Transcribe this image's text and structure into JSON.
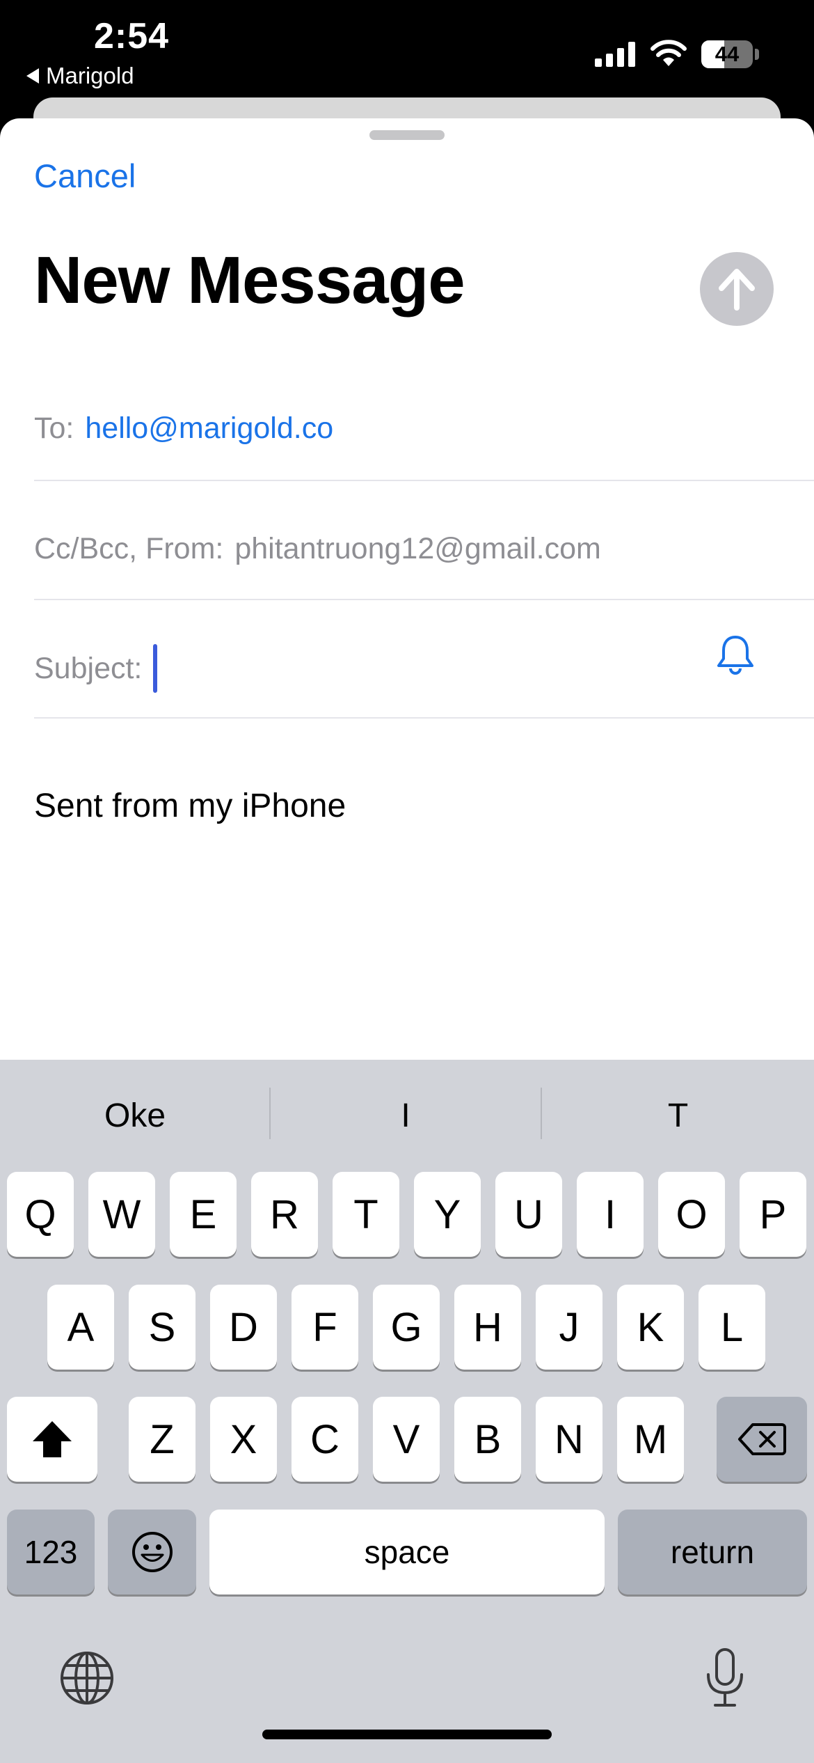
{
  "status_bar": {
    "time": "2:54",
    "back_app": "Marigold",
    "battery_percent": 44
  },
  "compose": {
    "cancel_label": "Cancel",
    "title": "New Message",
    "to_label": "To:",
    "to_value": "hello@marigold.co",
    "ccbcc_label": "Cc/Bcc, From:",
    "from_value": "phitantruong12@gmail.com",
    "subject_label": "Subject:",
    "subject_value": "",
    "body": "Sent from my iPhone",
    "colors": {
      "accent": "#1a73e8",
      "send_disabled": "#c7c7cc",
      "cursor": "#3b5bdb"
    }
  },
  "keyboard": {
    "suggestions": [
      "Oke",
      "I",
      "T"
    ],
    "row1": [
      "Q",
      "W",
      "E",
      "R",
      "T",
      "Y",
      "U",
      "I",
      "O",
      "P"
    ],
    "row2": [
      "A",
      "S",
      "D",
      "F",
      "G",
      "H",
      "J",
      "K",
      "L"
    ],
    "row3": [
      "Z",
      "X",
      "C",
      "V",
      "B",
      "N",
      "M"
    ],
    "numbers_label": "123",
    "space_label": "space",
    "return_label": "return",
    "icons": [
      "shift-icon",
      "delete-icon",
      "emoji-icon",
      "globe-icon",
      "microphone-icon"
    ]
  }
}
